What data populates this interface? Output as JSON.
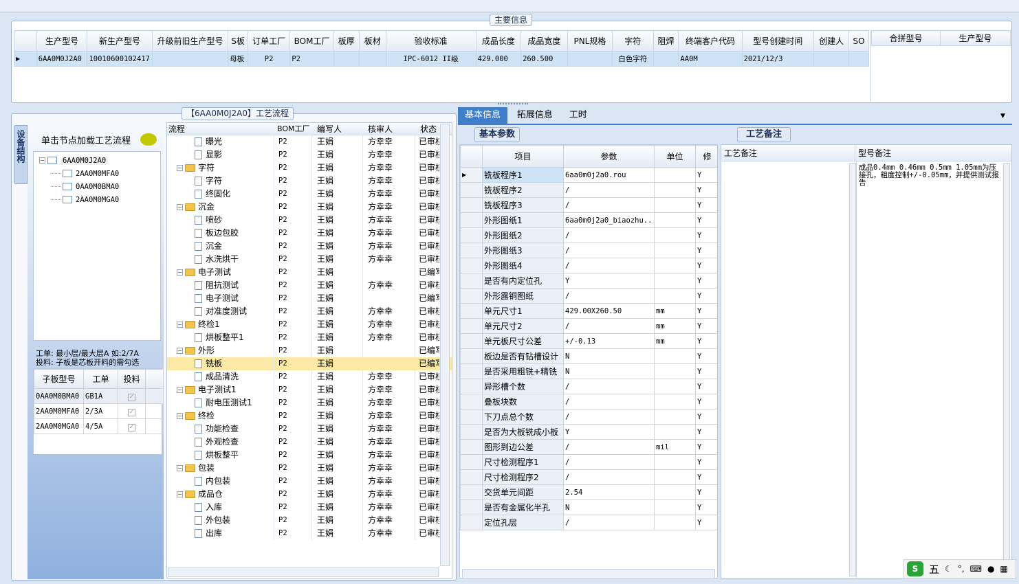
{
  "main_info": {
    "title": "主要信息",
    "columns": [
      "生产型号",
      "新生产型号",
      "升级前旧生产型号",
      "S板",
      "订单工厂",
      "BOM工厂",
      "板厚",
      "板材",
      "验收标准",
      "成品长度",
      "成品宽度",
      "PNL规格",
      "字符",
      "阻焊",
      "终端客户代码",
      "型号创建时间",
      "创建人",
      "SO"
    ],
    "row": [
      "6AA0M0J2A0",
      "10010600102417",
      "",
      "母板",
      "P2",
      "P2",
      "",
      "",
      "IPC-6012 II级",
      "429.000",
      "260.500",
      "",
      "白色字符",
      "",
      "AA0M",
      "2021/12/3",
      "",
      ""
    ],
    "merge_columns": [
      "合拼型号",
      "生产型号"
    ]
  },
  "left_panel": {
    "vertical_tab": "设备结构",
    "hint": "单击节点加载工艺流程",
    "tree_root": "6AA0M0J2A0",
    "tree_children": [
      "2AA0M0MFA0",
      "0AA0M0BMA0",
      "2AA0M0MGA0"
    ],
    "note_line1": "工单: 最小层/最大层A 如:2/7A",
    "note_line2": "投料: 子板是芯板开料的需勾选",
    "sub_columns": [
      "子板型号",
      "工单",
      "投料"
    ],
    "sub_rows": [
      {
        "model": "0AA0M0BMA0",
        "order": "GB1A"
      },
      {
        "model": "2AA0M0MFA0",
        "order": "2/3A"
      },
      {
        "model": "2AA0M0MGA0",
        "order": "4/5A"
      }
    ]
  },
  "process": {
    "title": "【6AA0M0J2A0】工艺流程",
    "columns": [
      "流程",
      "BOM工厂",
      "编写人",
      "核审人",
      "状态"
    ],
    "rows": [
      {
        "type": "child",
        "name": "曝光",
        "bom": "P2",
        "writer": "王娟",
        "reviewer": "方幸幸",
        "status": "已审核"
      },
      {
        "type": "child",
        "name": "显影",
        "bom": "P2",
        "writer": "王娟",
        "reviewer": "方幸幸",
        "status": "已审核"
      },
      {
        "type": "group",
        "name": "字符",
        "bom": "P2",
        "writer": "王娟",
        "reviewer": "方幸幸",
        "status": "已审核"
      },
      {
        "type": "child",
        "name": "字符",
        "bom": "P2",
        "writer": "王娟",
        "reviewer": "方幸幸",
        "status": "已审核"
      },
      {
        "type": "child",
        "name": "终固化",
        "bom": "P2",
        "writer": "王娟",
        "reviewer": "方幸幸",
        "status": "已审核"
      },
      {
        "type": "group",
        "name": "沉金",
        "bom": "P2",
        "writer": "王娟",
        "reviewer": "方幸幸",
        "status": "已审核"
      },
      {
        "type": "child",
        "name": "喷砂",
        "bom": "P2",
        "writer": "王娟",
        "reviewer": "方幸幸",
        "status": "已审核"
      },
      {
        "type": "child",
        "name": "板边包胶",
        "bom": "P2",
        "writer": "王娟",
        "reviewer": "方幸幸",
        "status": "已审核"
      },
      {
        "type": "child",
        "name": "沉金",
        "bom": "P2",
        "writer": "王娟",
        "reviewer": "方幸幸",
        "status": "已审核"
      },
      {
        "type": "child",
        "name": "水洗烘干",
        "bom": "P2",
        "writer": "王娟",
        "reviewer": "方幸幸",
        "status": "已审核"
      },
      {
        "type": "group",
        "name": "电子测试",
        "bom": "P2",
        "writer": "王娟",
        "reviewer": "",
        "status": "已编写"
      },
      {
        "type": "child",
        "name": "阻抗测试",
        "bom": "P2",
        "writer": "王娟",
        "reviewer": "方幸幸",
        "status": "已审核"
      },
      {
        "type": "child",
        "name": "电子测试",
        "bom": "P2",
        "writer": "王娟",
        "reviewer": "",
        "status": "已编写"
      },
      {
        "type": "child",
        "name": "对准度测试",
        "bom": "P2",
        "writer": "王娟",
        "reviewer": "方幸幸",
        "status": "已审核"
      },
      {
        "type": "group",
        "name": "终检1",
        "bom": "P2",
        "writer": "王娟",
        "reviewer": "方幸幸",
        "status": "已审核"
      },
      {
        "type": "child",
        "name": "烘板整平1",
        "bom": "P2",
        "writer": "王娟",
        "reviewer": "方幸幸",
        "status": "已审核"
      },
      {
        "type": "group",
        "name": "外形",
        "bom": "P2",
        "writer": "王娟",
        "reviewer": "",
        "status": "已编写"
      },
      {
        "type": "child",
        "name": "铣板",
        "bom": "P2",
        "writer": "王娟",
        "reviewer": "",
        "status": "已编写",
        "selected": true
      },
      {
        "type": "child",
        "name": "成品清洗",
        "bom": "P2",
        "writer": "王娟",
        "reviewer": "方幸幸",
        "status": "已审核"
      },
      {
        "type": "group",
        "name": "电子测试1",
        "bom": "P2",
        "writer": "王娟",
        "reviewer": "方幸幸",
        "status": "已审核"
      },
      {
        "type": "child",
        "name": "耐电压测试1",
        "bom": "P2",
        "writer": "王娟",
        "reviewer": "方幸幸",
        "status": "已审核"
      },
      {
        "type": "group",
        "name": "终检",
        "bom": "P2",
        "writer": "王娟",
        "reviewer": "方幸幸",
        "status": "已审核"
      },
      {
        "type": "child",
        "name": "功能检查",
        "bom": "P2",
        "writer": "王娟",
        "reviewer": "方幸幸",
        "status": "已审核"
      },
      {
        "type": "child",
        "name": "外观检查",
        "bom": "P2",
        "writer": "王娟",
        "reviewer": "方幸幸",
        "status": "已审核"
      },
      {
        "type": "child",
        "name": "烘板整平",
        "bom": "P2",
        "writer": "王娟",
        "reviewer": "方幸幸",
        "status": "已审核"
      },
      {
        "type": "group",
        "name": "包装",
        "bom": "P2",
        "writer": "王娟",
        "reviewer": "方幸幸",
        "status": "已审核"
      },
      {
        "type": "child",
        "name": "内包装",
        "bom": "P2",
        "writer": "王娟",
        "reviewer": "方幸幸",
        "status": "已审核"
      },
      {
        "type": "group",
        "name": "成品仓",
        "bom": "P2",
        "writer": "王娟",
        "reviewer": "方幸幸",
        "status": "已审核"
      },
      {
        "type": "child",
        "name": "入库",
        "bom": "P2",
        "writer": "王娟",
        "reviewer": "方幸幸",
        "status": "已审核"
      },
      {
        "type": "child",
        "name": "外包装",
        "bom": "P2",
        "writer": "王娟",
        "reviewer": "方幸幸",
        "status": "已审核"
      },
      {
        "type": "child",
        "name": "出库",
        "bom": "P2",
        "writer": "王娟",
        "reviewer": "方幸幸",
        "status": "已审核"
      }
    ]
  },
  "tabs": [
    "基本信息",
    "拓展信息",
    "工时"
  ],
  "basic_params": {
    "title": "基本参数",
    "columns": [
      "项目",
      "参数",
      "单位",
      "修"
    ],
    "rows": [
      {
        "item": "铣板程序1",
        "value": "6aa0m0j2a0.rou",
        "unit": "",
        "flag": "Y"
      },
      {
        "item": "铣板程序2",
        "value": "/",
        "unit": "",
        "flag": "Y"
      },
      {
        "item": "铣板程序3",
        "value": "/",
        "unit": "",
        "flag": "Y"
      },
      {
        "item": "外形图纸1",
        "value": "6aa0m0j2a0_biaozhu...",
        "unit": "",
        "flag": "Y"
      },
      {
        "item": "外形图纸2",
        "value": "/",
        "unit": "",
        "flag": "Y"
      },
      {
        "item": "外形图纸3",
        "value": "/",
        "unit": "",
        "flag": "Y"
      },
      {
        "item": "外形图纸4",
        "value": "/",
        "unit": "",
        "flag": "Y"
      },
      {
        "item": "是否有内定位孔",
        "value": "Y",
        "unit": "",
        "flag": "Y"
      },
      {
        "item": "外形露铜图纸",
        "value": "/",
        "unit": "",
        "flag": "Y"
      },
      {
        "item": "单元尺寸1",
        "value": "429.00X260.50",
        "unit": "mm",
        "flag": "Y"
      },
      {
        "item": "单元尺寸2",
        "value": "/",
        "unit": "mm",
        "flag": "Y"
      },
      {
        "item": "单元板尺寸公差",
        "value": "+/-0.13",
        "unit": "mm",
        "flag": "Y"
      },
      {
        "item": "板边是否有钻槽设计",
        "value": "N",
        "unit": "",
        "flag": "Y"
      },
      {
        "item": "是否采用粗铣+精铣",
        "value": "N",
        "unit": "",
        "flag": "Y"
      },
      {
        "item": "异形槽个数",
        "value": "/",
        "unit": "",
        "flag": "Y"
      },
      {
        "item": "叠板块数",
        "value": "/",
        "unit": "",
        "flag": "Y"
      },
      {
        "item": "下刀点总个数",
        "value": "/",
        "unit": "",
        "flag": "Y"
      },
      {
        "item": "是否为大板铣成小板",
        "value": "Y",
        "unit": "",
        "flag": "Y"
      },
      {
        "item": "图形到边公差",
        "value": "/",
        "unit": "mil",
        "flag": "Y"
      },
      {
        "item": "尺寸检测程序1",
        "value": "/",
        "unit": "",
        "flag": "Y"
      },
      {
        "item": "尺寸检测程序2",
        "value": "/",
        "unit": "",
        "flag": "Y"
      },
      {
        "item": "交货单元间距",
        "value": "2.54",
        "unit": "",
        "flag": "Y"
      },
      {
        "item": "是否有金属化半孔",
        "value": "N",
        "unit": "",
        "flag": "Y"
      },
      {
        "item": "定位孔层",
        "value": "/",
        "unit": "",
        "flag": "Y"
      }
    ]
  },
  "process_notes": {
    "title": "工艺备注",
    "col1": "工艺备注",
    "col2": "型号备注",
    "model_note": "成品0.4mm 0.46mm 0.5mm 1.05mm为压接孔，粗度控制+/-0.05mm，并提供测试报告"
  },
  "ime_bar": {
    "label": "五"
  }
}
